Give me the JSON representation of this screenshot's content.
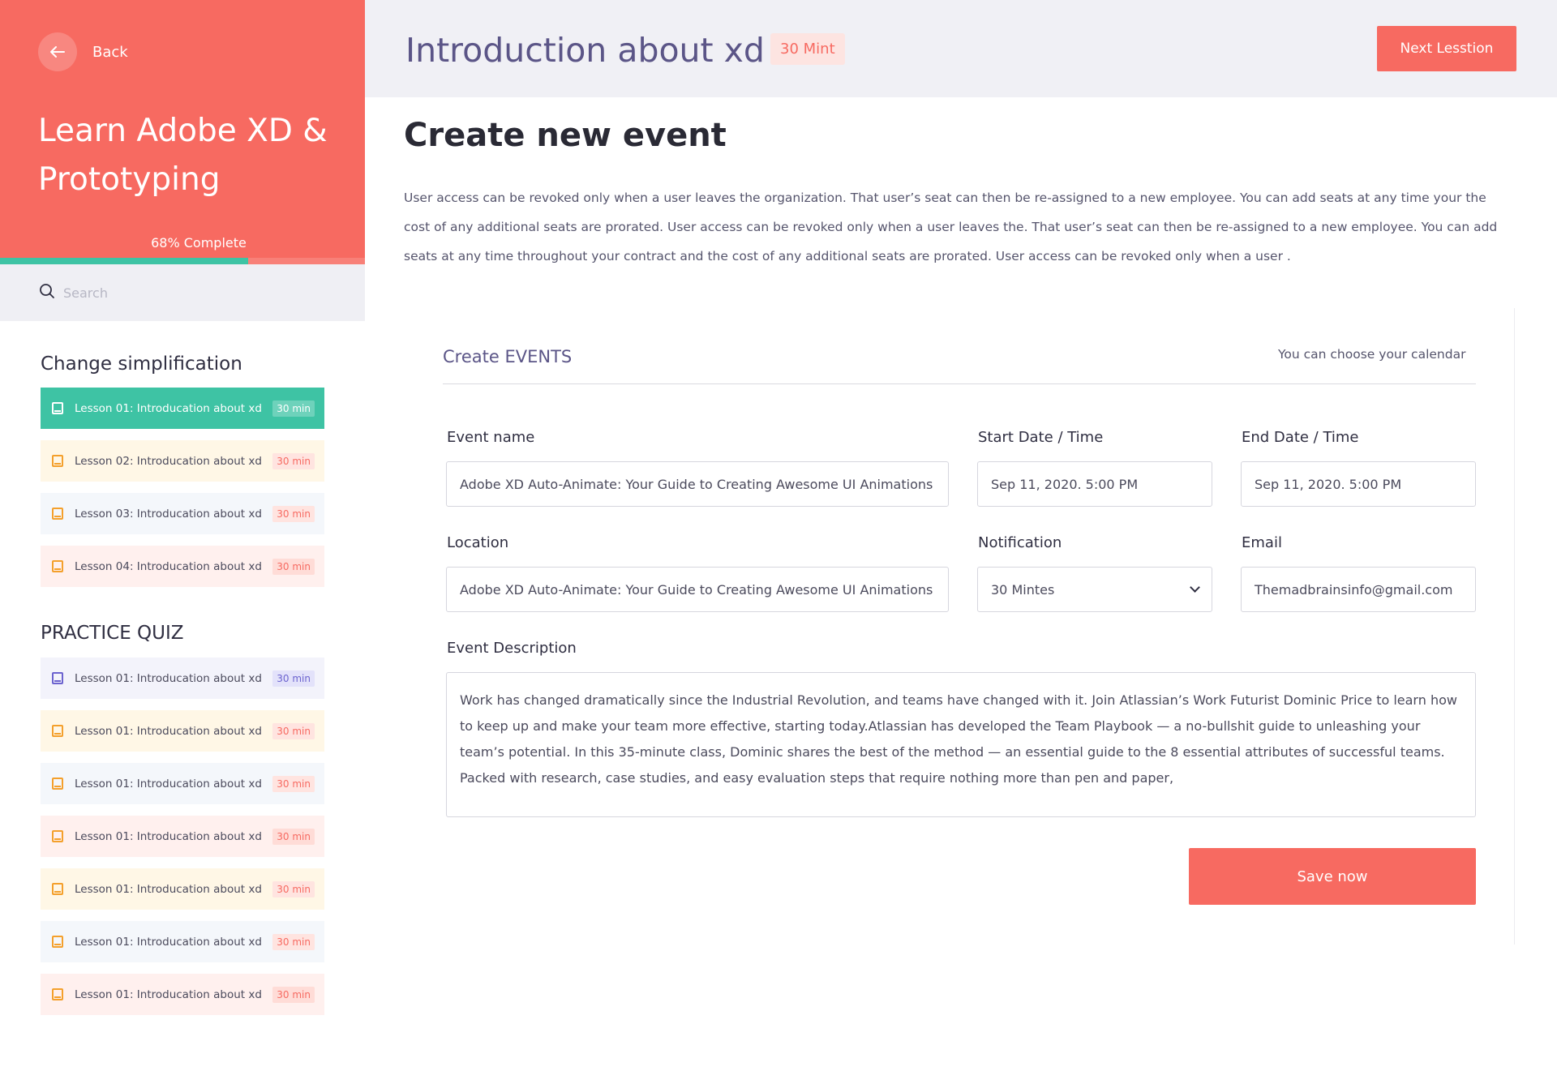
{
  "sidebar": {
    "back_label": "Back",
    "course_title": "Learn Adobe XD & Prototyping",
    "progress_label": "68% Complete",
    "progress_value": 0.68,
    "search_placeholder": "Search",
    "sections": [
      {
        "title": "Change simplification",
        "lessons": [
          {
            "label": "Lesson 01: Introducation about xd",
            "badge": "30 min",
            "theme": "active"
          },
          {
            "label": "Lesson 02: Introducation about xd",
            "badge": "30 min",
            "theme": "yellow"
          },
          {
            "label": "Lesson 03: Introducation about xd",
            "badge": "30 min",
            "theme": "blue"
          },
          {
            "label": "Lesson 04: Introducation about xd",
            "badge": "30 min",
            "theme": "pink"
          }
        ]
      },
      {
        "title": "PRACTICE QUIZ",
        "lessons": [
          {
            "label": "Lesson 01: Introducation about xd",
            "badge": "30 min",
            "theme": "lav"
          },
          {
            "label": "Lesson 01: Introducation about xd",
            "badge": "30 min",
            "theme": "yellow"
          },
          {
            "label": "Lesson 01: Introducation about xd",
            "badge": "30 min",
            "theme": "blue"
          },
          {
            "label": "Lesson 01: Introducation about xd",
            "badge": "30 min",
            "theme": "pink"
          },
          {
            "label": "Lesson 01: Introducation about xd",
            "badge": "30 min",
            "theme": "yellow"
          },
          {
            "label": "Lesson 01: Introducation about xd",
            "badge": "30 min",
            "theme": "blue"
          },
          {
            "label": "Lesson 01: Introducation about xd",
            "badge": "30 min",
            "theme": "pink"
          }
        ]
      }
    ]
  },
  "header": {
    "lesson_title": "Introduction about xd",
    "duration": "30 Mint",
    "next_label": "Next Lesstion"
  },
  "main": {
    "heading": "Create new event",
    "intro": "User access can be revoked only when a user leaves the organization. That user’s seat can then be re-assigned to a new employee. You can add seats at any time your the cost of any additional seats are prorated. User access can be revoked only when a user leaves the. That user’s seat can then be re-assigned to a new employee. You can add seats at any time throughout your contract and the cost of any additional seats are prorated. User access can be revoked only when a user ."
  },
  "form": {
    "title": "Create EVENTS",
    "hint": "You can choose your calendar",
    "event_name": {
      "label": "Event name",
      "value": "Adobe XD Auto-Animate: Your Guide to Creating Awesome UI Animations"
    },
    "start": {
      "label": "Start Date / Time",
      "value": "Sep 11, 2020.  5:00 PM"
    },
    "end": {
      "label": "End Date / Time",
      "value": "Sep 11, 2020.  5:00 PM"
    },
    "location": {
      "label": "Location",
      "value": "Adobe XD Auto-Animate: Your Guide to Creating Awesome UI Animations"
    },
    "notification": {
      "label": "Notification",
      "value": "30 Mintes"
    },
    "email": {
      "label": "Email",
      "value": "Themadbrainsinfo@gmail.com"
    },
    "description": {
      "label": "Event Description",
      "value": "Work has changed dramatically since the Industrial Revolution, and teams have changed with it. Join Atlassian’s Work Futurist Dominic Price to learn how to keep up and make your team more effective, starting today.Atlassian has developed the Team Playbook — a no-bullshit guide to unleashing your team’s potential. In this 35-minute class, Dominic shares the best of the method — an essential guide to the 8 essential attributes of successful teams. Packed with research, case studies, and easy evaluation steps that require nothing more than pen and paper,"
    },
    "save_label": "Save now"
  },
  "icons": {
    "back": "arrow-left-icon",
    "search": "search-icon",
    "lesson": "book-icon",
    "select": "chevron-down-icon"
  },
  "colors": {
    "brand": "#f76a61",
    "accent": "#3ec3a4",
    "heading_purple": "#5b5587"
  }
}
